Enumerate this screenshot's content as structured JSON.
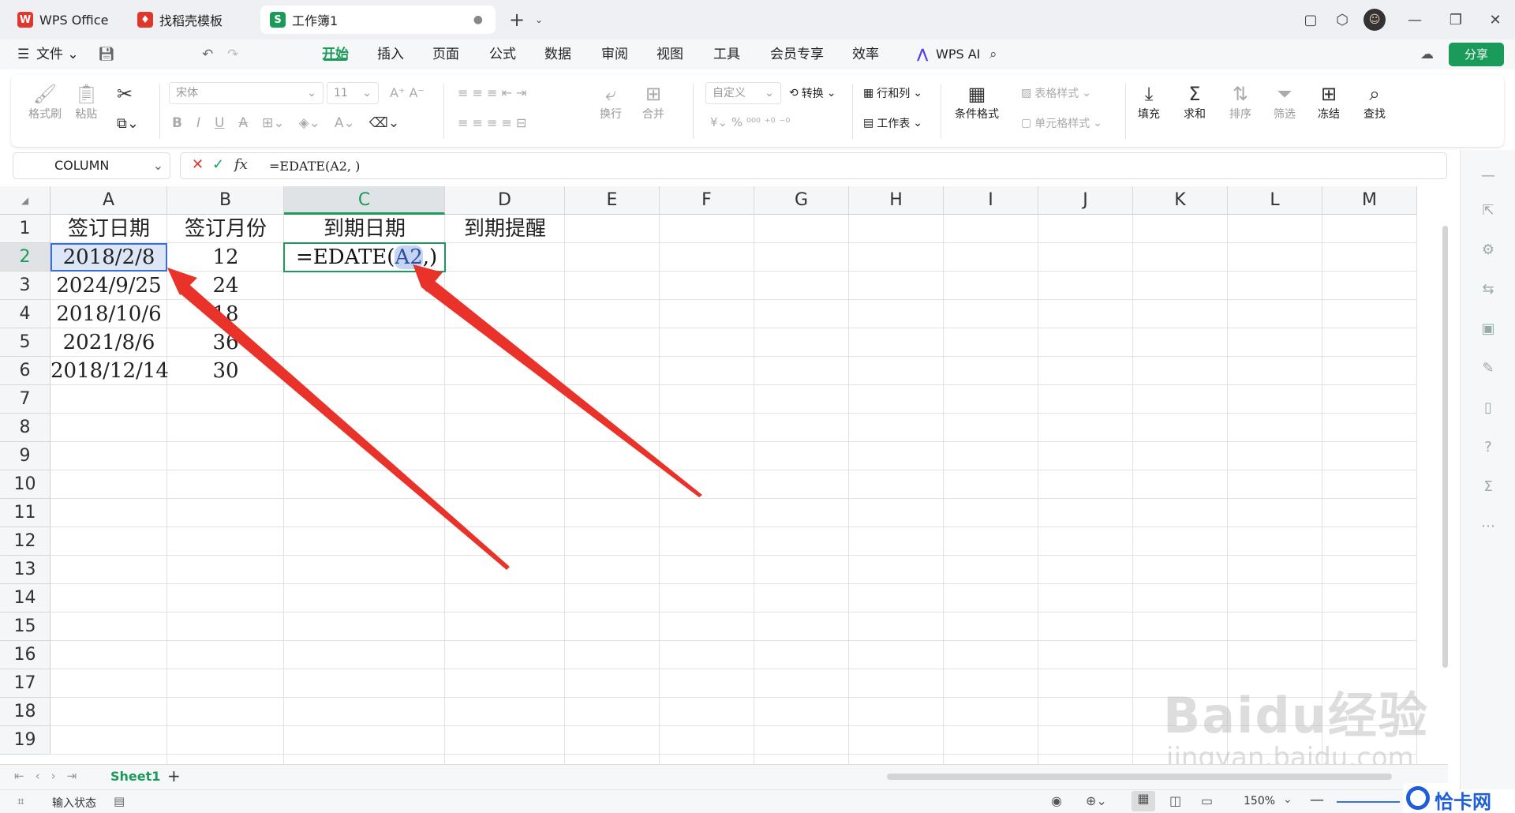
{
  "tabs": [
    {
      "label": "WPS Office",
      "icon": "wps-logo-icon",
      "color": "#e0362b"
    },
    {
      "label": "找稻壳模板",
      "icon": "docer-logo-icon",
      "color": "#e0362b"
    },
    {
      "label": "工作簿1",
      "icon": "spreadsheet-icon",
      "color": "#1a9b5a"
    }
  ],
  "menu": {
    "file": "文件",
    "items": [
      "开始",
      "插入",
      "页面",
      "公式",
      "数据",
      "审阅",
      "视图",
      "工具",
      "会员专享",
      "效率"
    ],
    "active": "开始",
    "wps_ai": "WPS AI",
    "share": "分享"
  },
  "ribbon": {
    "format_painter": "格式刷",
    "paste": "粘贴",
    "font": "宋体",
    "font_size": "11",
    "wrap": "换行",
    "merge": "合并",
    "number_format": "自定义",
    "convert": "转换",
    "rows_cols": "行和列",
    "worksheet": "工作表",
    "cond_format": "条件格式",
    "table_style": "表格样式",
    "cell_style": "单元格样式",
    "fill": "填充",
    "sum": "求和",
    "sort": "排序",
    "filter": "筛选",
    "freeze": "冻结",
    "find": "查找"
  },
  "namebox": "COLUMN",
  "formula": "=EDATE(A2, )",
  "columns": [
    "A",
    "B",
    "C",
    "D",
    "E",
    "F",
    "G",
    "H",
    "I",
    "J",
    "K",
    "L",
    "M"
  ],
  "rows": [
    "1",
    "2",
    "3",
    "4",
    "5",
    "6",
    "7",
    "8",
    "9",
    "10",
    "11",
    "12",
    "13",
    "14",
    "15",
    "16",
    "17",
    "18",
    "19"
  ],
  "cells": {
    "A1": "签订日期",
    "B1": "签订月份",
    "C1": "到期日期",
    "D1": "到期提醒",
    "A2": "2018/2/8",
    "B2": "12",
    "C2_prefix": "=EDATE(",
    "C2_ref": "A2",
    "C2_suffix": ",)",
    "A3": "2024/9/25",
    "B3": "24",
    "A4": "2018/10/6",
    "B4": "18",
    "A5": "2021/8/6",
    "B5": "36",
    "A6": "2018/12/14",
    "B6": "30"
  },
  "sheet": {
    "name": "Sheet1"
  },
  "status": {
    "mode": "输入状态",
    "zoom": "150%"
  },
  "watermark": {
    "brand": "Baidu经验",
    "url": "jingyan.baidu.com",
    "corner": "恰卡网"
  },
  "colors": {
    "accent": "#1a9b5a",
    "arrow": "#e8322a",
    "ref_highlight": "#c5d4f2"
  }
}
